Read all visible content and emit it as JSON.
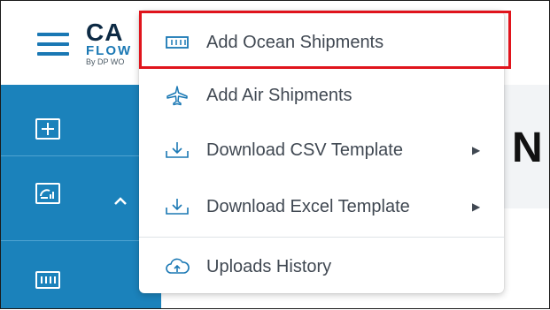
{
  "app": {
    "logo_line1": "CA",
    "logo_line2": "FLOW",
    "logo_line3": "By DP WO"
  },
  "background": {
    "heading_letter": "N"
  },
  "menu": {
    "items": [
      {
        "label": "Add Ocean Shipments",
        "icon": "container-icon",
        "submenu": false
      },
      {
        "label": "Add Air Shipments",
        "icon": "airplane-icon",
        "submenu": false
      },
      {
        "label": "Download CSV Template",
        "icon": "download-icon",
        "submenu": true
      },
      {
        "label": "Download Excel Template",
        "icon": "download-icon",
        "submenu": true
      },
      {
        "label": "Uploads History",
        "icon": "cloud-upload-icon",
        "submenu": false
      }
    ],
    "highlighted_item": "Add Ocean Shipments"
  },
  "sidebar": {
    "icons": [
      "add-box-icon",
      "dashboard-icon",
      "container-icon"
    ],
    "expand_chevron": "chevron-up-icon"
  },
  "colors": {
    "sidebar_bg": "#1b82bb",
    "accent": "#1a78b4",
    "highlight_border": "#e0141c",
    "menu_text": "#404852"
  }
}
